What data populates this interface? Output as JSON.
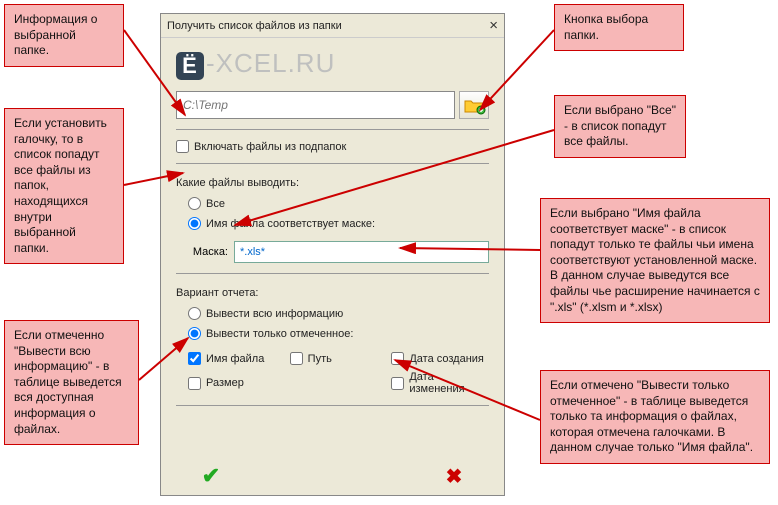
{
  "callouts": {
    "c1": "Информация о выбранной папке.",
    "c2": "Кнопка выбора папки.",
    "c3": "Если установить галочку, то в список попадут все файлы из папок, находящихся внутри выбранной папки.",
    "c4": "Если выбрано \"Все\" - в список попадут все файлы.",
    "c5": "Если выбрано \"Имя файла соответствует маске\" - в список попадут только те файлы чьи имена соответствуют установленной маске. В данном случае выведутся все файлы чье расширение начинается с \".xls\" (*.xlsm и *.xlsx)",
    "c6": "Если отмеченно \"Вывести всю информацию\" - в таблице выведется вся доступная информация о файлах.",
    "c7": "Если отмечено \"Вывести только отмеченное\" - в таблице выведется только та информация о файлах, которая отмечена галочками. В данном случае только \"Имя файла\"."
  },
  "dialog": {
    "title": "Получить список файлов из папки",
    "logo_text": "-XCEL.RU",
    "logo_badge": "Ё",
    "path_placeholder": "C:\\Temp",
    "include_subfolders": "Включать файлы из подпапок",
    "which_files": "Какие файлы выводить:",
    "opt_all": "Все",
    "opt_mask": "Имя файла соответствует маске:",
    "mask_label": "Маска:",
    "mask_value": "*.xls*",
    "report_variant": "Вариант отчета:",
    "opt_fullinfo": "Вывести всю информацию",
    "opt_selected": "Вывести только отмеченное:",
    "chk_name": "Имя файла",
    "chk_path": "Путь",
    "chk_created": "Дата создания",
    "chk_size": "Размер",
    "chk_modified": "Дата изменения"
  }
}
